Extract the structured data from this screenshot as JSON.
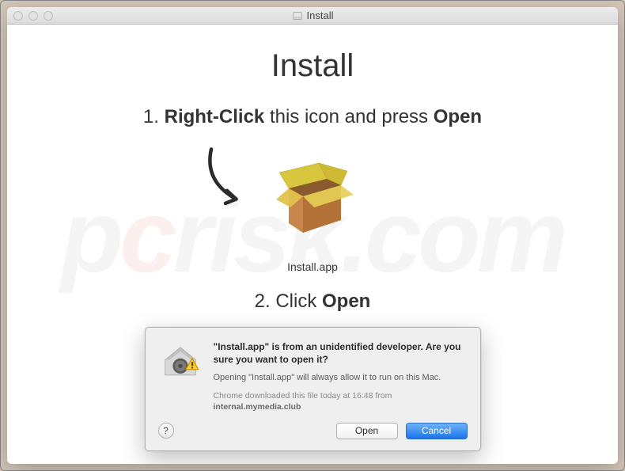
{
  "window": {
    "title": "Install"
  },
  "content": {
    "main_title": "Install",
    "step1": {
      "prefix": "1. ",
      "bold1": "Right-Click",
      "mid": " this icon and press ",
      "bold2": "Open"
    },
    "app_label": "Install.app",
    "step2": {
      "prefix": "2. Click ",
      "bold": "Open"
    }
  },
  "dialog": {
    "heading": "\"Install.app\" is from an unidentified developer. Are you sure you want to open it?",
    "subtext": "Opening \"Install.app\" will always allow it to run on this Mac.",
    "meta_prefix": "Chrome downloaded this file today at 16:48 from ",
    "meta_domain": "internal.mymedia.club",
    "help_label": "?",
    "open_label": "Open",
    "cancel_label": "Cancel"
  },
  "icons": {
    "box": "package-box-icon",
    "arrow": "curved-arrow-icon",
    "gatekeeper": "gatekeeper-warning-icon",
    "help": "help-icon"
  },
  "watermark": {
    "p": "p",
    "c": "c",
    "rest": "risk.com"
  }
}
